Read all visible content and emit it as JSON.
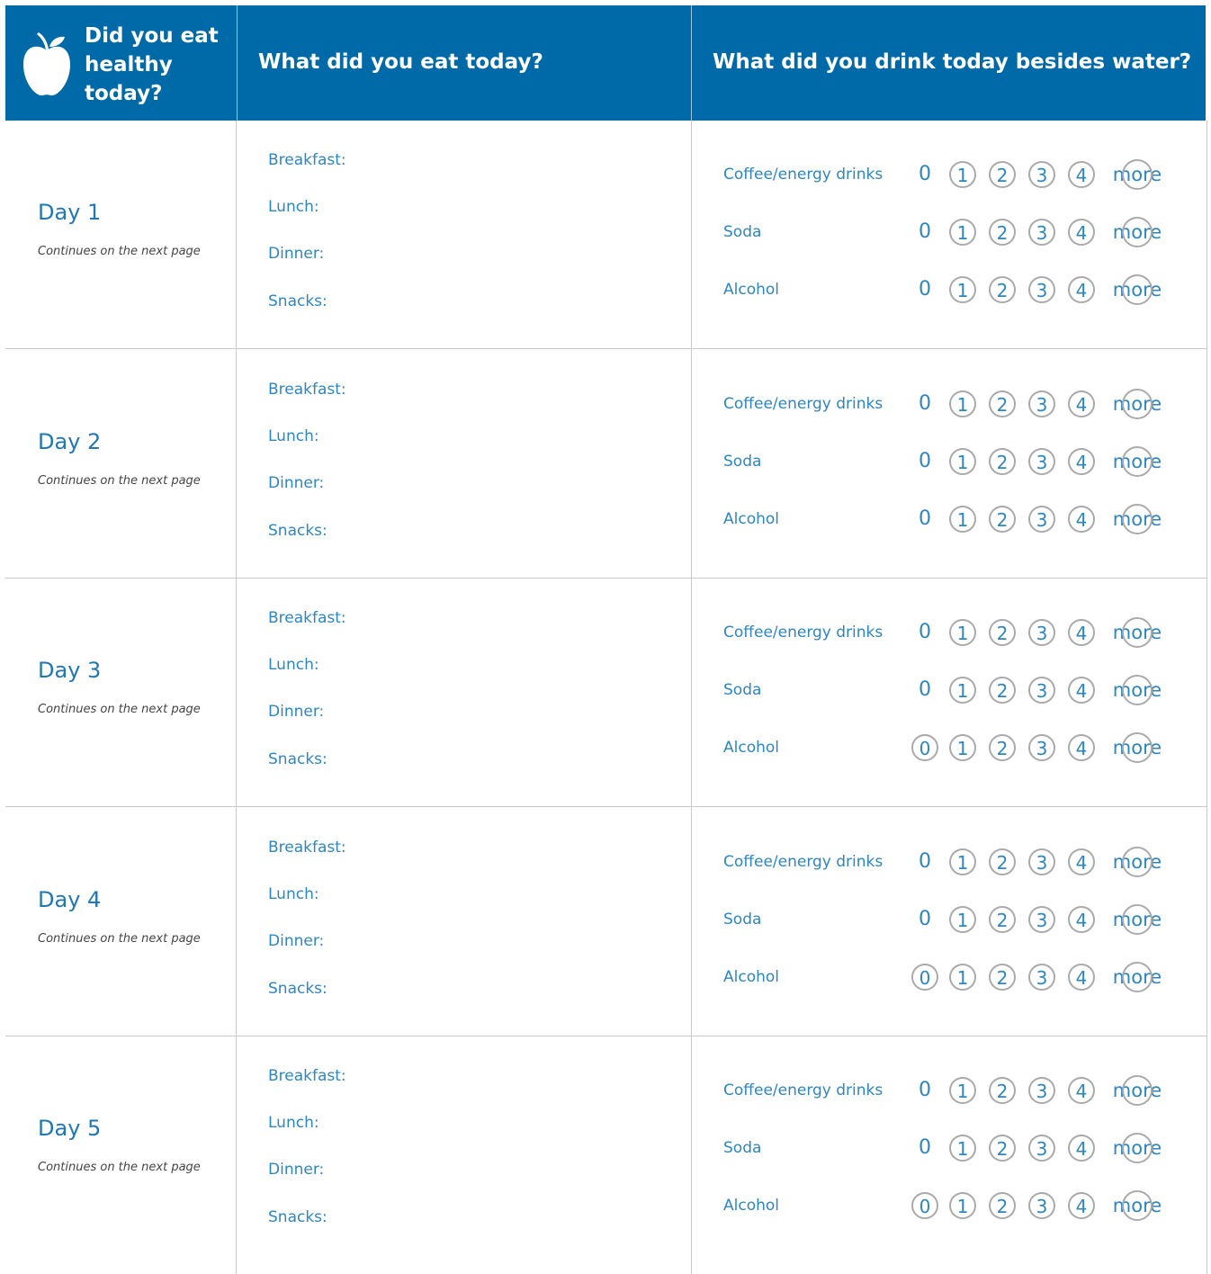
{
  "header": {
    "col1_title": "Did you eat healthy today?",
    "col2_title": "What did you eat today?",
    "col3_title": "What did you drink today besides water?",
    "icon": "apple-icon",
    "bg_color": "#006aa8"
  },
  "meal_labels": [
    "Breakfast:",
    "Lunch:",
    "Dinner:",
    "Snacks:"
  ],
  "drink_labels": [
    "Coffee/energy drinks",
    "Soda",
    "Alcohol"
  ],
  "scale_options": [
    "0",
    "1",
    "2",
    "3",
    "4",
    "more"
  ],
  "days": [
    {
      "title": "Day 1",
      "note": "Continues on the next page"
    },
    {
      "title": "Day 2",
      "note": "Continues on the next page"
    },
    {
      "title": "Day 3",
      "note": "Continues on the next page"
    },
    {
      "title": "Day 4",
      "note": "Continues on the next page"
    },
    {
      "title": "Day 5",
      "note": "Continues on the next page"
    }
  ]
}
